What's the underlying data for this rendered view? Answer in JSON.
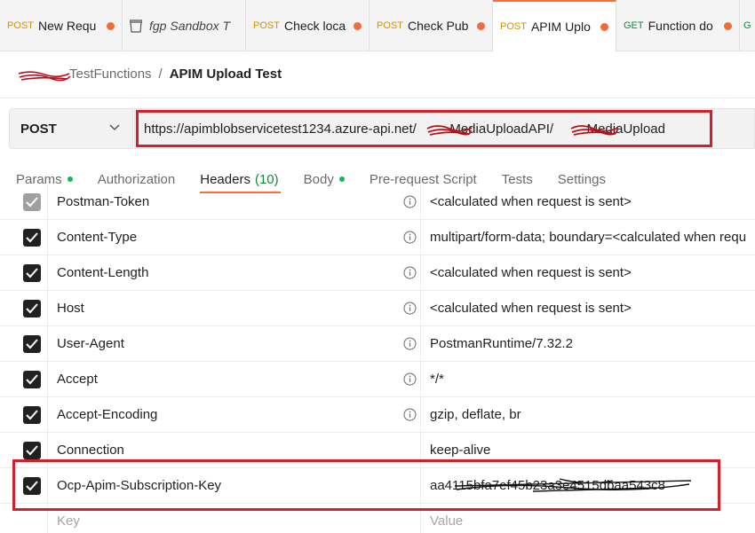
{
  "tabs": [
    {
      "method": "POST",
      "title": "New Requ",
      "dot": true
    },
    {
      "method": "",
      "title": "fgp Sandbox T",
      "dot": false,
      "icon": "box-icon"
    },
    {
      "method": "POST",
      "title": "Check loca",
      "dot": true
    },
    {
      "method": "POST",
      "title": "Check Pub",
      "dot": true
    },
    {
      "method": "POST",
      "title": "APIM Uplo",
      "dot": true,
      "active": true
    },
    {
      "method": "GET",
      "title": "Function do",
      "dot": true
    },
    {
      "method": "G",
      "title": "",
      "dot": false
    }
  ],
  "breadcrumb": {
    "parent": "TestFunctions",
    "separator": "/",
    "current": "APIM Upload Test"
  },
  "request": {
    "method": "POST",
    "url": "https://apimblobservicetest1234.azure-api.net/         MediaUploadAPI/         MediaUpload"
  },
  "subtabs": {
    "params": "Params",
    "authorization": "Authorization",
    "headers": "Headers",
    "headers_count": "(10)",
    "body": "Body",
    "prerequest": "Pre-request Script",
    "tests": "Tests",
    "settings": "Settings"
  },
  "headers": [
    {
      "key": "Postman-Token",
      "value": "<calculated when request is sent>",
      "checked": true,
      "disabled": true
    },
    {
      "key": "Content-Type",
      "value": "multipart/form-data; boundary=<calculated when requ",
      "checked": true
    },
    {
      "key": "Content-Length",
      "value": "<calculated when request is sent>",
      "checked": true
    },
    {
      "key": "Host",
      "value": "<calculated when request is sent>",
      "checked": true
    },
    {
      "key": "User-Agent",
      "value": "PostmanRuntime/7.32.2",
      "checked": true
    },
    {
      "key": "Accept",
      "value": "*/*",
      "checked": true
    },
    {
      "key": "Accept-Encoding",
      "value": "gzip, deflate, br",
      "checked": true
    },
    {
      "key": "Connection",
      "value": "keep-alive",
      "checked": true
    },
    {
      "key": "Ocp-Apim-Subscription-Key",
      "value": "aa4115bfa7ef45b23a3e4515dbaa543c8",
      "checked": true
    }
  ],
  "new_row": {
    "key_placeholder": "Key",
    "value_placeholder": "Value"
  },
  "colors": {
    "accent": "#ff6c37",
    "highlight_border": "#d1202e",
    "status_green": "#0cbb52"
  }
}
